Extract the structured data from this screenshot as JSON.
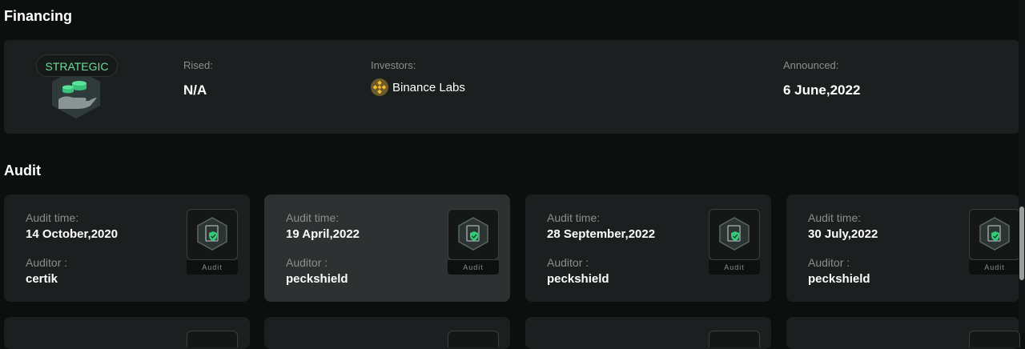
{
  "financing": {
    "title": "Financing",
    "badge_label": "STRATEGIC",
    "rised_label": "Rised:",
    "rised_value": "N/A",
    "investors_label": "Investors:",
    "investor_name": "Binance Labs",
    "announced_label": "Announced:",
    "announced_value": "6 June,2022"
  },
  "audit": {
    "title": "Audit",
    "time_label": "Audit time:",
    "auditor_label": "Auditor :",
    "badge_tag": "Audit",
    "cards": [
      {
        "time": "14 October,2020",
        "auditor": "certik"
      },
      {
        "time": "19 April,2022",
        "auditor": "peckshield"
      },
      {
        "time": "28 September,2022",
        "auditor": "peckshield"
      },
      {
        "time": "30 July,2022",
        "auditor": "peckshield"
      }
    ]
  },
  "colors": {
    "accent_green": "#6fdc9a",
    "card_bg": "#1c1f1f",
    "card_active_bg": "#2d3131",
    "page_bg": "#0b0f0e"
  }
}
